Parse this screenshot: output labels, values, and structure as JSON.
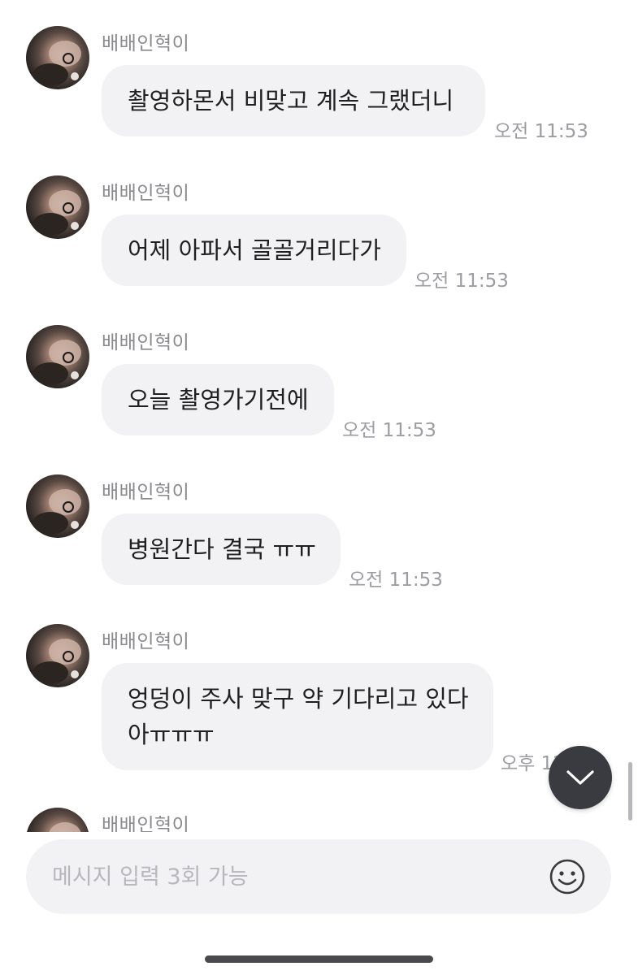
{
  "messages": [
    {
      "sender": "배배인혁이",
      "lines": [
        "촬영하몬서 비맞고 계속 그랬더니"
      ],
      "time": "오전 11:53"
    },
    {
      "sender": "배배인혁이",
      "lines": [
        "어제 아파서 골골거리다가"
      ],
      "time": "오전 11:53"
    },
    {
      "sender": "배배인혁이",
      "lines": [
        "오늘 촬영가기전에"
      ],
      "time": "오전 11:53"
    },
    {
      "sender": "배배인혁이",
      "lines": [
        "병원간다 결국 ㅠㅠ"
      ],
      "time": "오전 11:53"
    },
    {
      "sender": "배배인혁이",
      "lines": [
        "엉덩이 주사 맞구 약 기다리고 있다",
        "아ㅠㅠㅠ"
      ],
      "time": "오후 12"
    },
    {
      "sender": "배배인혁이"
    }
  ],
  "input": {
    "placeholder": "메시지 입력 3회 가능"
  },
  "icons": {
    "scroll_down": "chevron-down-icon",
    "emoji": "smiley-icon"
  },
  "colors": {
    "bubble": "#f2f2f4",
    "scroll_button": "#3a3b40",
    "muted_text": "#9c9ca2"
  }
}
